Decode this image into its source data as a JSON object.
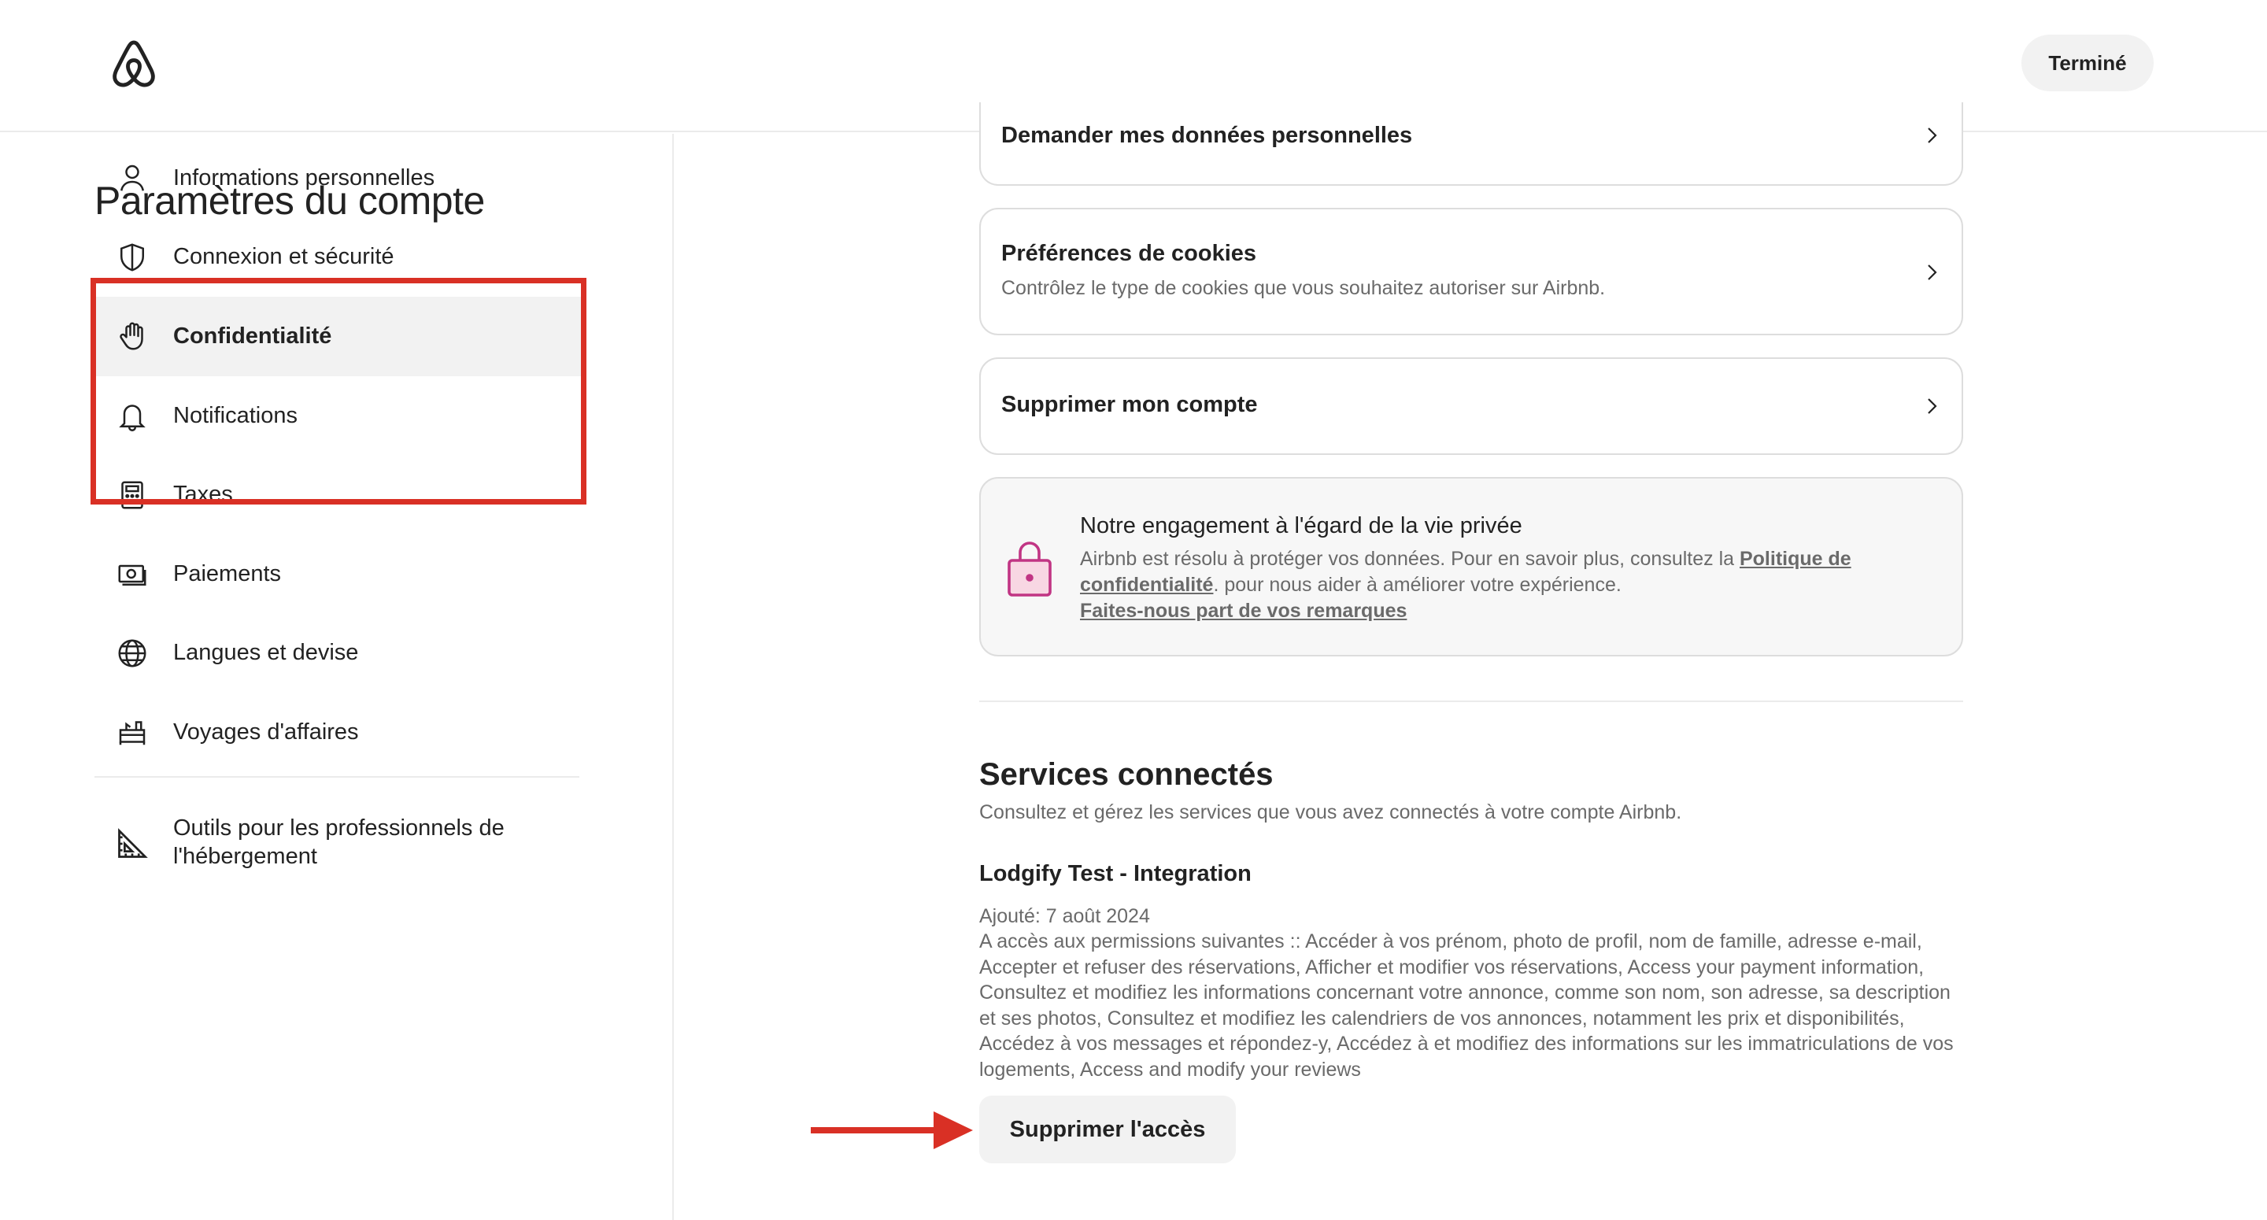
{
  "header": {
    "done_label": "Terminé"
  },
  "sidebar": {
    "title": "Paramètres du compte",
    "items": [
      {
        "label": "Informations personnelles",
        "icon": "person-icon"
      },
      {
        "label": "Connexion et sécurité",
        "icon": "shield-icon"
      },
      {
        "label": "Confidentialité",
        "icon": "hand-icon",
        "active": true
      },
      {
        "label": "Notifications",
        "icon": "bell-icon"
      },
      {
        "label": "Taxes",
        "icon": "calculator-icon"
      },
      {
        "label": "Paiements",
        "icon": "payment-icon"
      },
      {
        "label": "Langues et devise",
        "icon": "globe-icon"
      },
      {
        "label": "Voyages d'affaires",
        "icon": "briefcase-icon"
      }
    ],
    "pro_tools_label": "Outils pour les professionnels de l'hébergement"
  },
  "main": {
    "request_data_label": "Demander mes données personnelles",
    "cookies": {
      "title": "Préférences de cookies",
      "subtitle": "Contrôlez le type de cookies que vous souhaitez autoriser sur Airbnb."
    },
    "delete_account_label": "Supprimer mon compte",
    "privacy": {
      "title": "Notre engagement à l'égard de la vie privée",
      "text_before": "Airbnb est résolu à protéger vos données. Pour en savoir plus, consultez la ",
      "policy_link": "Politique de confidentialité",
      "text_after": ". pour nous aider à améliorer votre expérience.",
      "feedback_link": "Faites-nous part de vos remarques"
    },
    "connected_services": {
      "title": "Services connectés",
      "subtitle": "Consultez et gérez les services que vous avez connectés à votre compte Airbnb.",
      "service_name": "Lodgify Test - Integration",
      "added": "Ajouté: 7 août 2024",
      "permissions": "A accès aux permissions suivantes :: Accéder à vos prénom, photo de profil, nom de famille, adresse e-mail, Accepter et refuser des réservations, Afficher et modifier vos réservations, Access your payment information, Consultez et modifiez les informations concernant votre annonce, comme son nom, son adresse, sa description et ses photos, Consultez et modifiez les calendriers de vos annonces, notamment les prix et disponibilités, Accédez à vos messages et répondez-y, Accédez à et modifiez des informations sur les immatriculations de vos logements, Access and modify your reviews",
      "remove_label": "Supprimer l'accès"
    }
  },
  "colors": {
    "brand": "#ff385c",
    "annotation_red": "#d93025",
    "privacy_lock": "#c13584"
  }
}
